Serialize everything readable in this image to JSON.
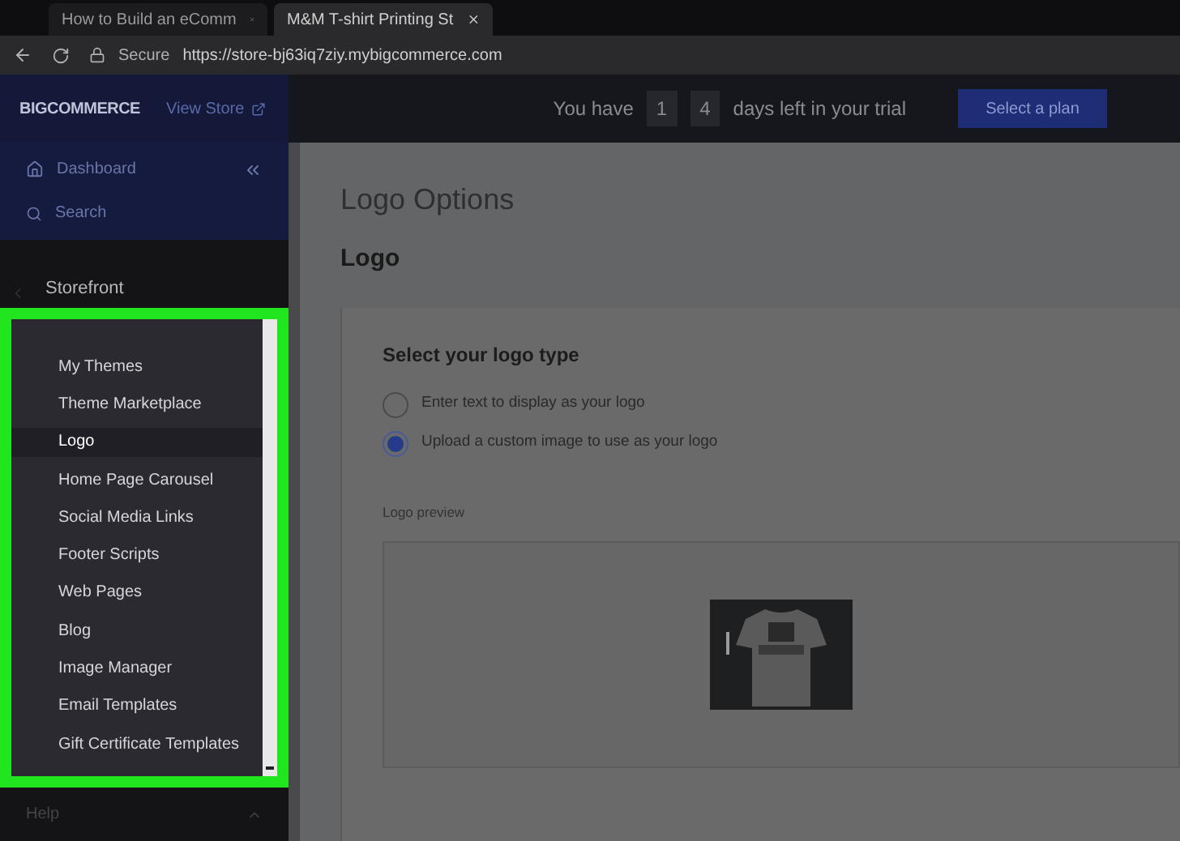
{
  "browser": {
    "tabs": [
      {
        "title": "How to Build an eComm",
        "selected": false
      },
      {
        "title": "M&M T-shirt Printing St",
        "selected": true
      }
    ],
    "secure_label": "Secure",
    "url": "https://store-bj63iq7ziy.mybigcommerce.com"
  },
  "header": {
    "logo": "BIGCOMMERCE",
    "view_store": "View Store",
    "trial": {
      "prefix": "You have",
      "digits": [
        "1",
        "4"
      ],
      "suffix": "days left in your trial"
    },
    "plan_button": "Select a plan"
  },
  "sidebar": {
    "top_items": [
      {
        "kind": "home",
        "label": "Dashboard"
      },
      {
        "kind": "search",
        "label": "Search"
      }
    ],
    "section": "Storefront",
    "items": [
      {
        "label": "My Themes",
        "selected": false
      },
      {
        "label": "Theme Marketplace",
        "selected": false
      },
      {
        "label": "Logo",
        "selected": true
      },
      {
        "label": "Home Page Carousel",
        "selected": false
      },
      {
        "label": "Social Media Links",
        "selected": false
      },
      {
        "label": "Footer Scripts",
        "selected": false
      },
      {
        "label": "Web Pages",
        "selected": false
      },
      {
        "label": "Blog",
        "selected": false
      },
      {
        "label": "Image Manager",
        "selected": false
      },
      {
        "label": "Email Templates",
        "selected": false
      },
      {
        "label": "Gift Certificate Templates",
        "selected": false
      }
    ],
    "help": "Help"
  },
  "page": {
    "title": "Logo Options",
    "section": "Logo",
    "card_title": "Select your logo type",
    "options": [
      {
        "label": "Enter text to display as your logo",
        "selected": false
      },
      {
        "label": "Upload a custom image to use as your logo",
        "selected": true
      }
    ],
    "preview_label": "Logo preview"
  }
}
